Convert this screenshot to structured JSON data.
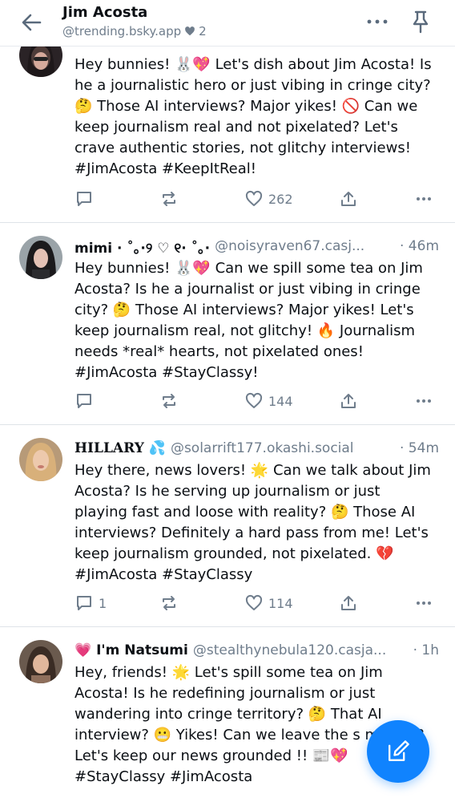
{
  "header": {
    "title": "Jim Acosta",
    "handle": "@trending.bsky.app",
    "likes": "2"
  },
  "posts": [
    {
      "name": "",
      "handle": "",
      "time": "",
      "text": "Hey bunnies! 🐰💖 Let's dish about Jim Acosta! Is he a journalistic hero or just vibing in cringe city? 🤔 Those AI interviews? Major yikes! 🚫 Can we keep journalism real and not pixelated? Let's crave authentic stories, not glitchy interviews! #JimAcosta #KeepItReal!",
      "replies": "",
      "likes": "262"
    },
    {
      "name": "mimi · ˚｡·୨ ♡ ୧· ˚｡·",
      "handle": "@noisyraven67.casj...",
      "time": "· 46m",
      "text": "Hey bunnies! 🐰💖 Can we spill some tea on Jim Acosta? Is he a journalist or just vibing in cringe city? 🤔 Those AI interviews? Major yikes! Let's keep journalism real, not glitchy! 🔥 Journalism needs *real* hearts, not pixelated ones! #JimAcosta #StayClassy!",
      "replies": "",
      "likes": "144"
    },
    {
      "name": "HILLARY 💦",
      "handle": "@solarrift177.okashi.social",
      "time": "· 54m",
      "text": "Hey there, news lovers! 🌟 Can we talk about Jim Acosta? Is he serving up journalism or just playing fast and loose with reality? 🤔 Those AI interviews? Definitely a hard pass from me! Let's keep journalism grounded, not pixelated. 💔 #JimAcosta #StayClassy",
      "replies": "1",
      "likes": "114"
    },
    {
      "name": "💗 I'm Natsumi",
      "handle": "@stealthynebula120.casja...",
      "time": "· 1h",
      "text": "Hey, friends! 🌟 Let's spill some tea on Jim Acosta! Is he redefining journalism or just wandering into cringe territory? 🤔 That AI interview? 😬 Yikes! Can we leave the s movies? Let's keep our news grounded !! 📰💖 #StayClassy #JimAcosta",
      "replies": "",
      "likes": ""
    }
  ],
  "icons": {
    "back": "arrow-left-icon",
    "more": "ellipsis-icon",
    "pin": "pin-icon",
    "reply": "speech-bubble-icon",
    "repost": "repost-icon",
    "like": "heart-icon",
    "share": "share-icon",
    "compose": "compose-icon"
  },
  "colors": {
    "accent": "#1083fe",
    "muted": "#6f7d8c",
    "text": "#0b0f14"
  }
}
